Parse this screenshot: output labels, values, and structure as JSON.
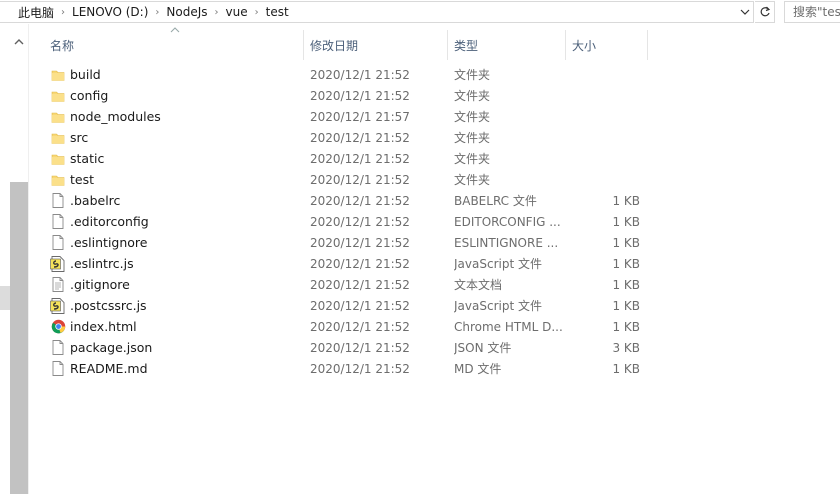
{
  "address": {
    "breadcrumbs": [
      "此电脑",
      "LENOVO (D:)",
      "NodeJs",
      "vue",
      "test"
    ],
    "search_placeholder": "搜索\"test\""
  },
  "columns": {
    "name": "名称",
    "date": "修改日期",
    "type": "类型",
    "size": "大小"
  },
  "files": [
    {
      "name": "build",
      "date": "2020/12/1 21:52",
      "type": "文件夹",
      "size": "",
      "icon": "folder-icon"
    },
    {
      "name": "config",
      "date": "2020/12/1 21:52",
      "type": "文件夹",
      "size": "",
      "icon": "folder-icon"
    },
    {
      "name": "node_modules",
      "date": "2020/12/1 21:57",
      "type": "文件夹",
      "size": "",
      "icon": "folder-icon"
    },
    {
      "name": "src",
      "date": "2020/12/1 21:52",
      "type": "文件夹",
      "size": "",
      "icon": "folder-icon"
    },
    {
      "name": "static",
      "date": "2020/12/1 21:52",
      "type": "文件夹",
      "size": "",
      "icon": "folder-icon"
    },
    {
      "name": "test",
      "date": "2020/12/1 21:52",
      "type": "文件夹",
      "size": "",
      "icon": "folder-icon"
    },
    {
      "name": ".babelrc",
      "date": "2020/12/1 21:52",
      "type": "BABELRC 文件",
      "size": "1 KB",
      "icon": "file-icon"
    },
    {
      "name": ".editorconfig",
      "date": "2020/12/1 21:52",
      "type": "EDITORCONFIG ...",
      "size": "1 KB",
      "icon": "file-icon"
    },
    {
      "name": ".eslintignore",
      "date": "2020/12/1 21:52",
      "type": "ESLINTIGNORE ...",
      "size": "1 KB",
      "icon": "file-icon"
    },
    {
      "name": ".eslintrc.js",
      "date": "2020/12/1 21:52",
      "type": "JavaScript 文件",
      "size": "1 KB",
      "icon": "js-file-icon"
    },
    {
      "name": ".gitignore",
      "date": "2020/12/1 21:52",
      "type": "文本文档",
      "size": "1 KB",
      "icon": "text-file-icon"
    },
    {
      "name": ".postcssrc.js",
      "date": "2020/12/1 21:52",
      "type": "JavaScript 文件",
      "size": "1 KB",
      "icon": "js-file-icon"
    },
    {
      "name": "index.html",
      "date": "2020/12/1 21:52",
      "type": "Chrome HTML D...",
      "size": "1 KB",
      "icon": "chrome-icon"
    },
    {
      "name": "package.json",
      "date": "2020/12/1 21:52",
      "type": "JSON 文件",
      "size": "3 KB",
      "icon": "file-icon"
    },
    {
      "name": "README.md",
      "date": "2020/12/1 21:52",
      "type": "MD 文件",
      "size": "1 KB",
      "icon": "file-icon"
    }
  ],
  "colors": {
    "folder": "#f8d775",
    "header_text": "#4c607a",
    "secondary_text": "#6d6d6d"
  }
}
